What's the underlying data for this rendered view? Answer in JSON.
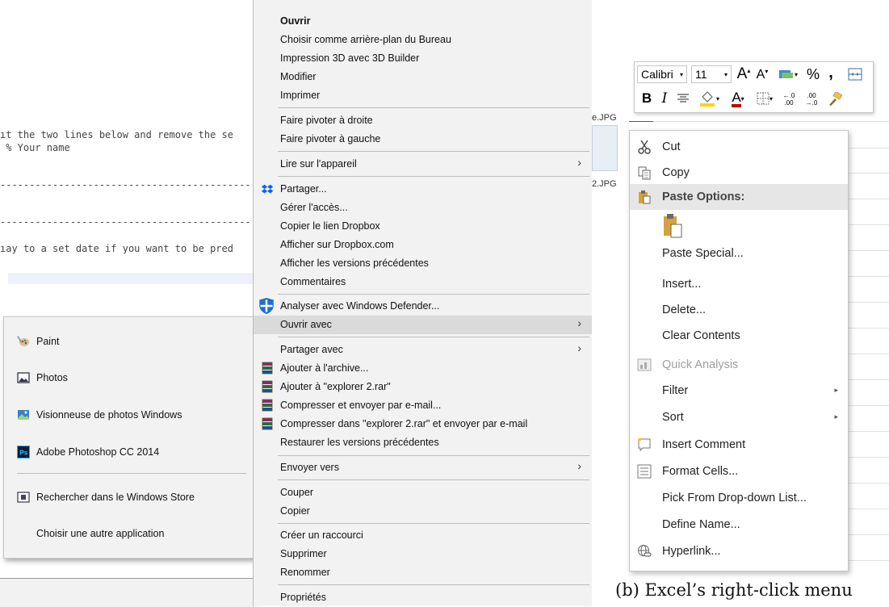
{
  "editor": {
    "lines": [
      "ıt the two lines below and remove the se",
      " % Your name",
      "-------------------------------------------",
      "-------------------------------------------",
      "ıay to a set date if you want to be pred"
    ]
  },
  "open_with_menu": {
    "items": [
      {
        "label": "Paint",
        "icon": "paint-icon"
      },
      {
        "label": "Photos",
        "icon": "photos-icon"
      },
      {
        "label": "Visionneuse de photos Windows",
        "icon": "photo-viewer-icon"
      },
      {
        "label": "Adobe Photoshop CC 2014",
        "icon": "photoshop-icon"
      },
      {
        "label": "Rechercher dans le Windows Store",
        "icon": "store-icon"
      },
      {
        "label": "Choisir une autre application",
        "icon": ""
      }
    ]
  },
  "windows_menu": {
    "items": [
      {
        "label": "Ouvrir",
        "bold": true
      },
      {
        "label": "Choisir comme arrière-plan du Bureau"
      },
      {
        "label": "Impression 3D avec 3D Builder"
      },
      {
        "label": "Modifier"
      },
      {
        "label": "Imprimer"
      },
      {
        "label": "Faire pivoter à droite"
      },
      {
        "label": "Faire pivoter à gauche"
      },
      {
        "label": "Lire sur l'appareil",
        "submenu": true
      },
      {
        "label": "Partager...",
        "icon": "dropbox-icon"
      },
      {
        "label": "Gérer l'accès..."
      },
      {
        "label": "Copier le lien Dropbox"
      },
      {
        "label": "Afficher sur Dropbox.com"
      },
      {
        "label": "Afficher les versions précédentes"
      },
      {
        "label": "Commentaires"
      },
      {
        "label": "Analyser avec Windows Defender...",
        "icon": "defender-icon"
      },
      {
        "label": "Ouvrir avec",
        "submenu": true,
        "selected": true
      },
      {
        "label": "Partager avec",
        "submenu": true
      },
      {
        "label": "Ajouter à l'archive...",
        "icon": "winrar-icon"
      },
      {
        "label": "Ajouter à \"explorer 2.rar\"",
        "icon": "winrar-icon"
      },
      {
        "label": "Compresser et envoyer par e-mail...",
        "icon": "winrar-icon"
      },
      {
        "label": "Compresser dans \"explorer 2.rar\" et envoyer par e-mail",
        "icon": "winrar-icon"
      },
      {
        "label": "Restaurer les versions précédentes"
      },
      {
        "label": "Envoyer vers",
        "submenu": true
      },
      {
        "label": "Couper"
      },
      {
        "label": "Copier"
      },
      {
        "label": "Créer un raccourci"
      },
      {
        "label": "Supprimer"
      },
      {
        "label": "Renommer"
      },
      {
        "label": "Propriétés"
      }
    ],
    "arrow_glyph": "›"
  },
  "explorer_bg": {
    "file1": "e.JPG",
    "file2": "2.JPG"
  },
  "excel": {
    "ribbon": {
      "font_name": "Calibri",
      "font_size": "11",
      "grow_font": "A",
      "shrink_font": "A",
      "percent": "%",
      "comma": ",",
      "bold": "B",
      "italic": "I",
      "font_color_letter": "A",
      "increase_decimal": "←.0 .00",
      "decrease_decimal": ".00 →.0",
      "accent_font_color": "#c00000",
      "accent_fill_color": "#ffd400"
    },
    "menu": {
      "items": [
        {
          "label": "Cut",
          "icon": "scissors-icon"
        },
        {
          "label": "Copy",
          "icon": "copy-icon"
        },
        {
          "label": "Paste Options:",
          "icon": "paste-icon",
          "header": true
        },
        {
          "label": "",
          "icon": "paste-clipboard-icon"
        },
        {
          "label": "Paste Special..."
        },
        {
          "label": "Insert..."
        },
        {
          "label": "Delete..."
        },
        {
          "label": "Clear Contents"
        },
        {
          "label": "Quick Analysis",
          "icon": "quick-analysis-icon",
          "disabled": true
        },
        {
          "label": "Filter",
          "submenu": true
        },
        {
          "label": "Sort",
          "submenu": true
        },
        {
          "label": "Insert Comment",
          "icon": "comment-icon"
        },
        {
          "label": "Format Cells...",
          "icon": "format-cells-icon"
        },
        {
          "label": "Pick From Drop-down List..."
        },
        {
          "label": "Define Name..."
        },
        {
          "label": "Hyperlink...",
          "icon": "hyperlink-icon"
        }
      ],
      "arrow_glyph": "▸"
    },
    "caption": "(b) Excel’s right-click menu"
  }
}
